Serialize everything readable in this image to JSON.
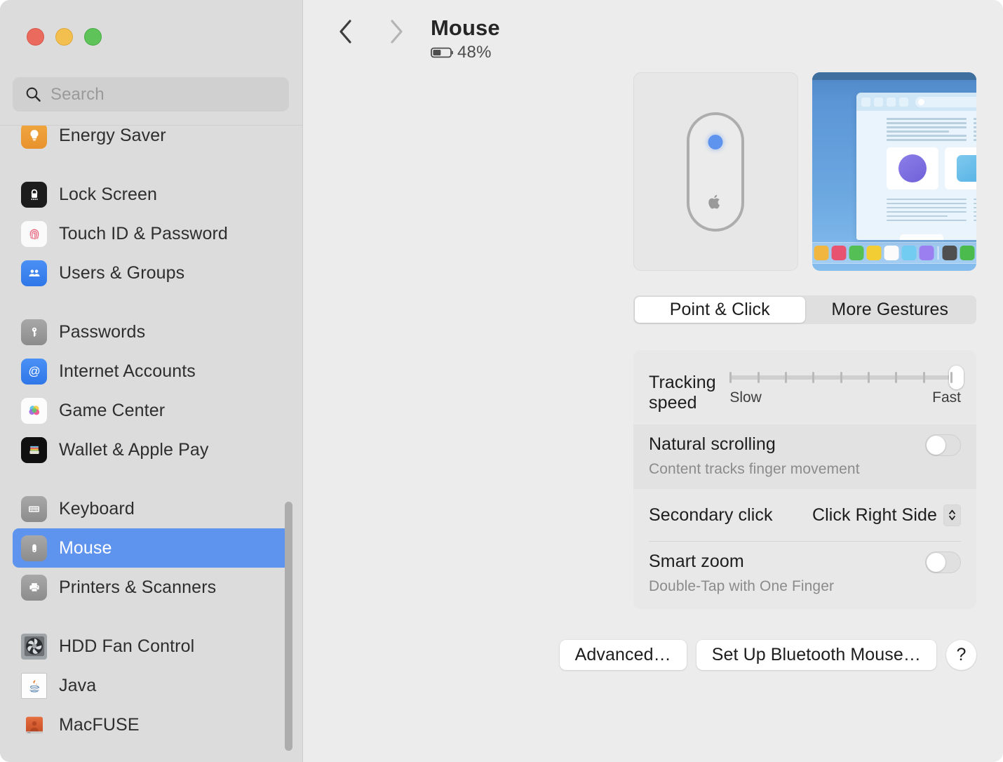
{
  "window": {
    "traffic_lights": [
      "close",
      "minimize",
      "zoom"
    ]
  },
  "search": {
    "placeholder": "Search"
  },
  "sidebar": {
    "groups": [
      {
        "items": [
          {
            "label": "Energy Saver",
            "icon": "energy-saver-icon",
            "selected": false,
            "partial": true
          }
        ]
      },
      {
        "items": [
          {
            "label": "Lock Screen",
            "icon": "lock-screen-icon",
            "selected": false
          },
          {
            "label": "Touch ID & Password",
            "icon": "touch-id-icon",
            "selected": false
          },
          {
            "label": "Users & Groups",
            "icon": "users-groups-icon",
            "selected": false
          }
        ]
      },
      {
        "items": [
          {
            "label": "Passwords",
            "icon": "passwords-icon",
            "selected": false
          },
          {
            "label": "Internet Accounts",
            "icon": "internet-accounts-icon",
            "selected": false
          },
          {
            "label": "Game Center",
            "icon": "game-center-icon",
            "selected": false
          },
          {
            "label": "Wallet & Apple Pay",
            "icon": "wallet-icon",
            "selected": false
          }
        ]
      },
      {
        "items": [
          {
            "label": "Keyboard",
            "icon": "keyboard-icon",
            "selected": false
          },
          {
            "label": "Mouse",
            "icon": "mouse-icon",
            "selected": true
          },
          {
            "label": "Printers & Scanners",
            "icon": "printers-icon",
            "selected": false
          }
        ]
      },
      {
        "items": [
          {
            "label": "HDD Fan Control",
            "icon": "fan-icon",
            "selected": false
          },
          {
            "label": "Java",
            "icon": "java-icon",
            "selected": false
          },
          {
            "label": "MacFUSE",
            "icon": "macfuse-icon",
            "selected": false
          }
        ]
      }
    ]
  },
  "header": {
    "back_icon": "chevron-left-icon",
    "forward_icon": "chevron-right-icon",
    "title": "Mouse",
    "battery_percent": "48%",
    "battery_level": 48
  },
  "preview": {
    "mouse_device": "magic-mouse-illustration",
    "demo": "desktop-gesture-animation",
    "dock_colors": [
      "#3b8ef0",
      "#f0b63f",
      "#e85470",
      "#54bf55",
      "#f2cd34",
      "#fbfbfb",
      "#72cbf0",
      "#9b7ff0",
      "#4f4f4f",
      "#4cbb4e",
      "#b6b6b6"
    ]
  },
  "tabs": [
    {
      "label": "Point & Click",
      "active": true
    },
    {
      "label": "More Gestures",
      "active": false
    }
  ],
  "settings": {
    "tracking_speed": {
      "label": "Tracking speed",
      "min_label": "Slow",
      "max_label": "Fast",
      "ticks": 9,
      "value": 100
    },
    "natural_scrolling": {
      "label": "Natural scrolling",
      "sublabel": "Content tracks finger movement",
      "enabled": false
    },
    "secondary_click": {
      "label": "Secondary click",
      "value": "Click Right Side"
    },
    "smart_zoom": {
      "label": "Smart zoom",
      "sublabel": "Double-Tap with One Finger",
      "enabled": false
    }
  },
  "footer": {
    "advanced_label": "Advanced…",
    "setup_label": "Set Up Bluetooth Mouse…",
    "help_label": "?"
  },
  "colors": {
    "accent": "#5f94ee",
    "sidebar_bg": "#dcdcdc",
    "main_bg": "#ececec"
  }
}
